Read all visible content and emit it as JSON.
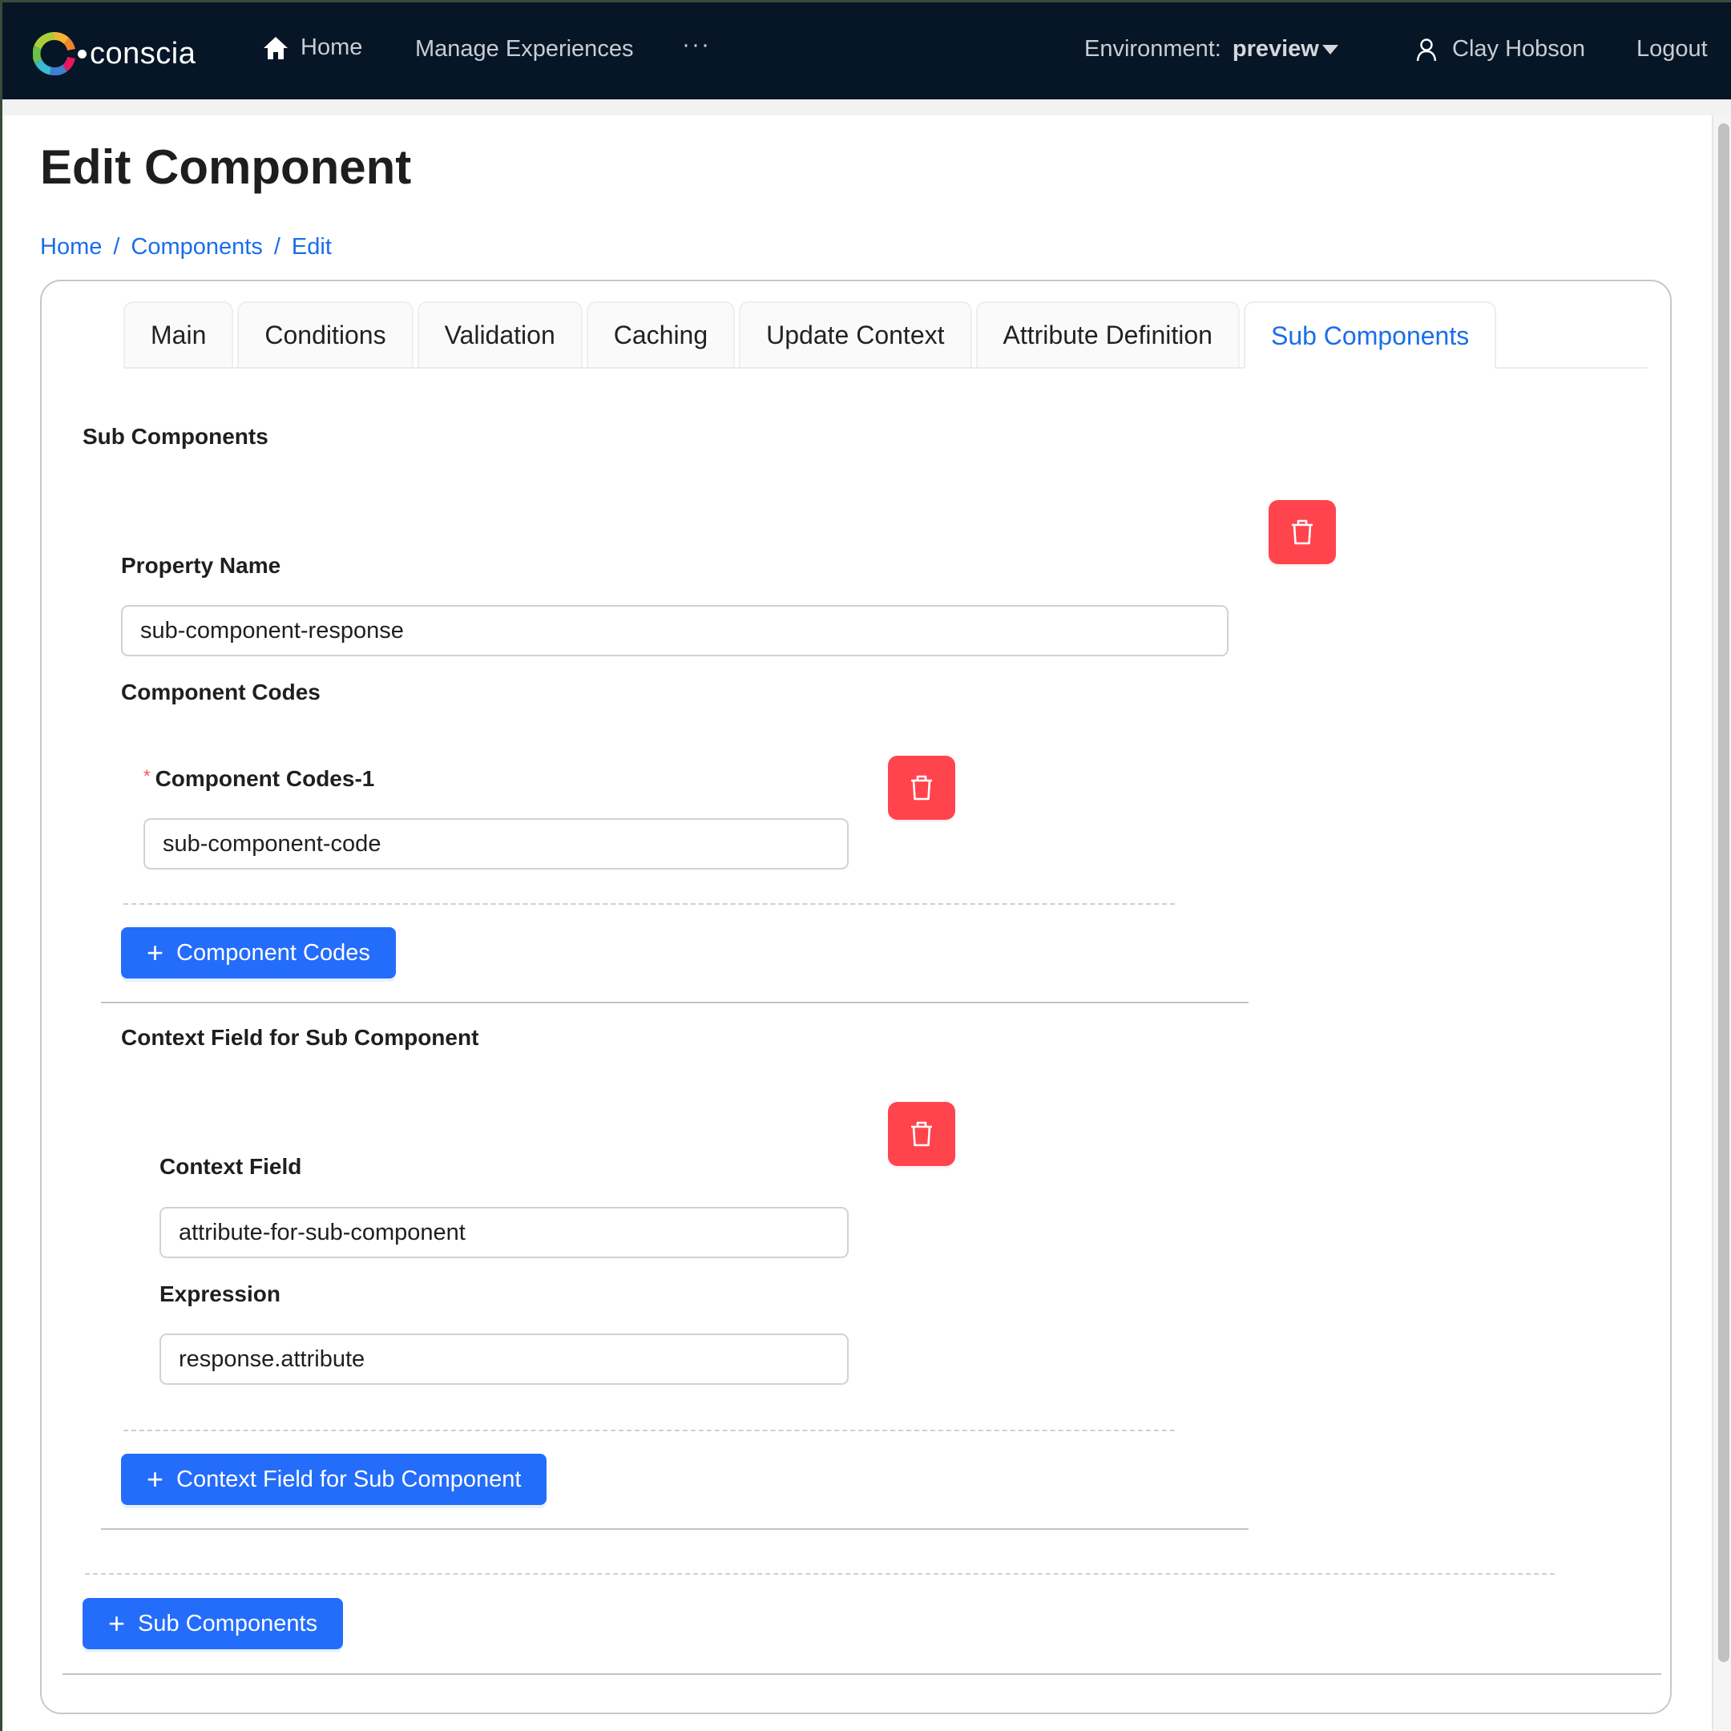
{
  "nav": {
    "brand": "conscia",
    "home": "Home",
    "manage_experiences": "Manage Experiences",
    "more": "···",
    "environment_label": "Environment:",
    "environment_value": "preview",
    "user_name": "Clay Hobson",
    "logout": "Logout",
    "icons": {
      "home": "home-icon",
      "user": "user-icon",
      "caret": "caret-down-icon"
    }
  },
  "page": {
    "title": "Edit Component",
    "breadcrumb": [
      {
        "label": "Home"
      },
      {
        "label": "Components"
      },
      {
        "label": "Edit"
      }
    ],
    "breadcrumb_separator": "/"
  },
  "tabs": [
    {
      "label": "Main",
      "active": false
    },
    {
      "label": "Conditions",
      "active": false
    },
    {
      "label": "Validation",
      "active": false
    },
    {
      "label": "Caching",
      "active": false
    },
    {
      "label": "Update Context",
      "active": false
    },
    {
      "label": "Attribute Definition",
      "active": false
    },
    {
      "label": "Sub Components",
      "active": true
    }
  ],
  "form": {
    "section_title": "Sub Components",
    "property_name": {
      "label": "Property Name",
      "value": "sub-component-response"
    },
    "component_codes": {
      "title": "Component Codes",
      "items": [
        {
          "label": "Component Codes-1",
          "required": true,
          "required_mark": "*",
          "value": "sub-component-code"
        }
      ],
      "add_button": "Component Codes"
    },
    "context_fields": {
      "title": "Context Field for Sub Component",
      "items": [
        {
          "context_field_label": "Context Field",
          "context_field_value": "attribute-for-sub-component",
          "expression_label": "Expression",
          "expression_value": "response.attribute"
        }
      ],
      "add_button": "Context Field for Sub Component"
    },
    "add_sub_component_button": "Sub Components",
    "add_icon": "+"
  },
  "colors": {
    "nav_bg": "#061627",
    "link": "#1a6ee8",
    "primary_button": "#246dfa",
    "danger_button": "#ff444d"
  }
}
